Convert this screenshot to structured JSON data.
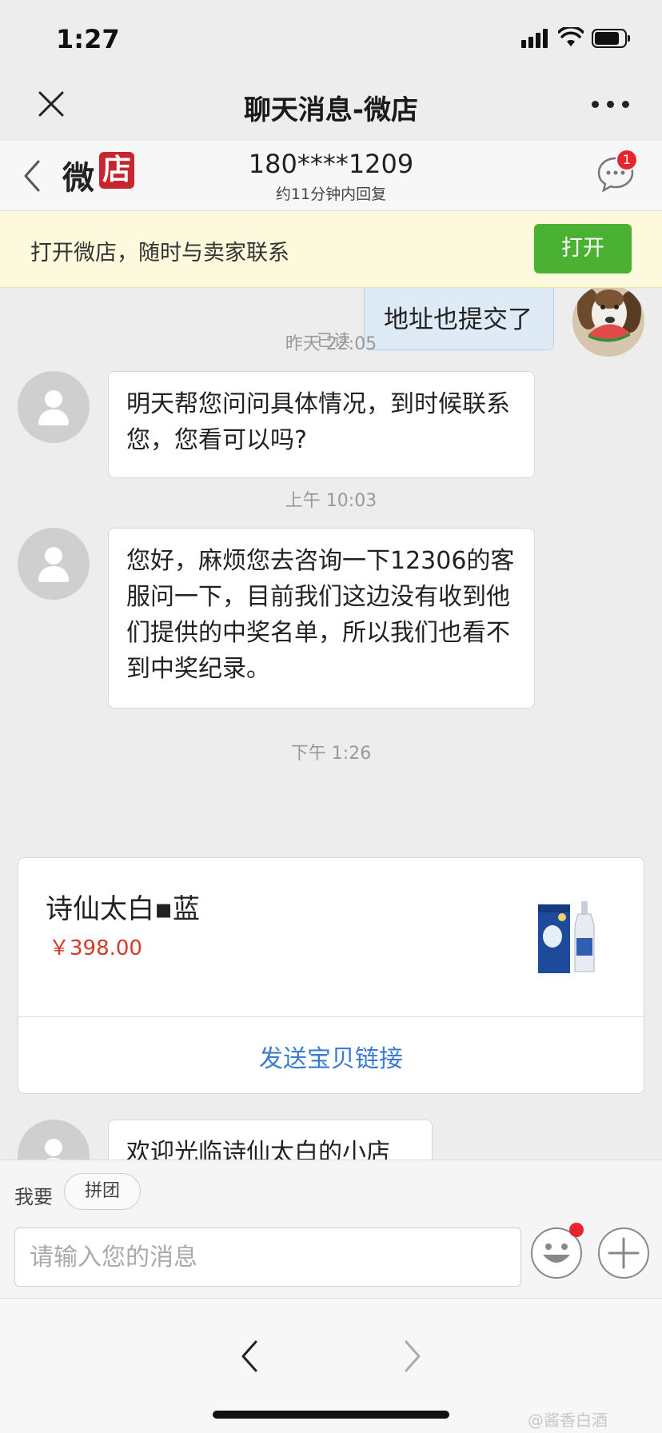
{
  "status_bar": {
    "time": "1:27"
  },
  "web_header": {
    "title": "聊天消息-微店"
  },
  "shop_nav": {
    "brand_left": "微",
    "brand_right": "店",
    "phone": "180****1209",
    "reply_hint": "约11分钟内回复",
    "badge_count": "1"
  },
  "promo": {
    "text": "打开微店，随时与卖家联系",
    "button": "打开"
  },
  "chat": {
    "read_label": "已读",
    "outgoing_message": "地址也提交了",
    "time1": "昨天 22:05",
    "message1": "明天帮您问问具体情况，到时候联系您，您看可以吗?",
    "time2": "上午 10:03",
    "message2": "您好，麻烦您去咨询一下12306的客服问一下，目前我们这边没有收到他们提供的中奖名单，所以我们也看不到中奖纪录。",
    "time3": "下午 1:26",
    "product": {
      "name": "诗仙太白▪蓝",
      "price": "￥398.00",
      "send_link": "发送宝贝链接"
    },
    "message3_partial": "欢迎光临诗仙太白的小店"
  },
  "input_area": {
    "want_label": "我要",
    "chip": "拼团",
    "placeholder": "请输入您的消息"
  },
  "watermark": "@酱香白酒"
}
